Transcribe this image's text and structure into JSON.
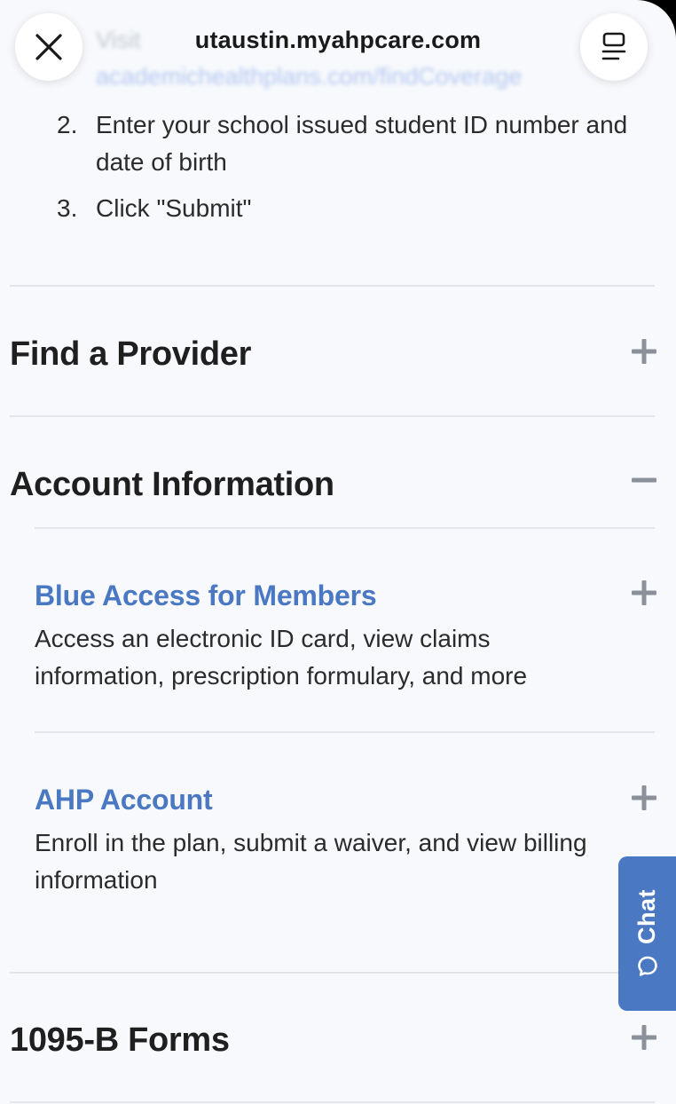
{
  "browser": {
    "url": "utaustin.myahpcare.com",
    "blurred_step_prefix": "Visit",
    "blurred_step_link": "academichealthplans.com/findCoverage"
  },
  "steps": [
    {
      "number": "2.",
      "text": "Enter your school issued student ID number and date of birth"
    },
    {
      "number": "3.",
      "text": "Click \"Submit\""
    }
  ],
  "sections": {
    "find_provider": {
      "title": "Find a Provider",
      "state": "collapsed"
    },
    "account_information": {
      "title": "Account Information",
      "state": "expanded",
      "items": [
        {
          "title": "Blue Access for Members",
          "description": "Access an electronic ID card, view claims information, prescription formulary, and more",
          "state": "collapsed"
        },
        {
          "title": "AHP Account",
          "description": "Enroll in the plan, submit a waiver, and view billing information",
          "state": "collapsed"
        }
      ]
    },
    "forms_1095b": {
      "title": "1095-B Forms",
      "state": "collapsed"
    }
  },
  "chat": {
    "label": "Chat"
  },
  "colors": {
    "accent": "#4a78c2",
    "background": "#f7f9fc",
    "divider": "#e2e6ea",
    "toggle_icon": "#8a919b",
    "text": "#2b2b2b"
  },
  "icons": {
    "close": "close-icon",
    "tabs": "tabs-icon",
    "expand": "plus-icon",
    "collapse": "minus-icon",
    "chat": "chat-bubble-icon"
  }
}
